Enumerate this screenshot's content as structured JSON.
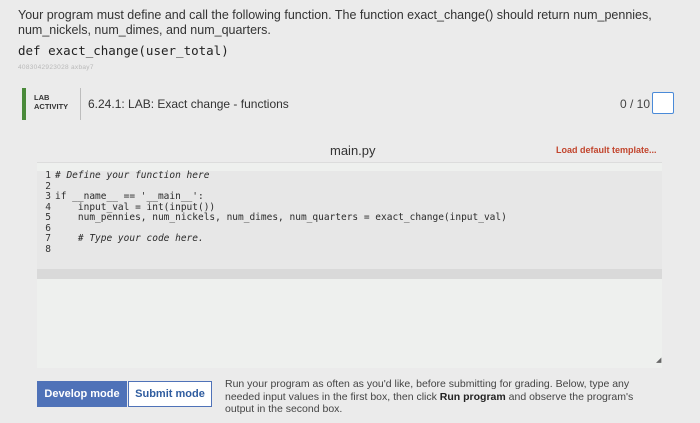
{
  "intro": {
    "text": "Your program must define and call the following function. The function exact_change() should return num_pennies, num_nickels, num_dimes, and num_quarters.",
    "signature": "def exact_change(user_total)"
  },
  "watermark": "4083042923028 axbay7",
  "lab": {
    "badge_line1": "LAB",
    "badge_line2": "ACTIVITY",
    "title": "6.24.1: LAB: Exact change - functions",
    "score": "0 / 10"
  },
  "editor": {
    "file_name": "main.py",
    "load_template": "Load default template...",
    "lines": [
      {
        "num": "1",
        "code": "# Define your function here"
      },
      {
        "num": "2",
        "code": ""
      },
      {
        "num": "3",
        "code": "if __name__ == '__main__':"
      },
      {
        "num": "4",
        "code": "    input_val = int(input())"
      },
      {
        "num": "5",
        "code": "    num_pennies, num_nickels, num_dimes, num_quarters = exact_change(input_val)"
      },
      {
        "num": "6",
        "code": ""
      },
      {
        "num": "7",
        "code": "    # Type your code here."
      },
      {
        "num": "8",
        "code": ""
      }
    ]
  },
  "buttons": {
    "develop": "Develop mode",
    "submit": "Submit mode"
  },
  "instructions": {
    "part1": "Run your program as often as you'd like, before submitting for grading. Below, type any needed input values in the first box, then click ",
    "bold": "Run program",
    "part2": " and observe the program's output in the second box."
  }
}
